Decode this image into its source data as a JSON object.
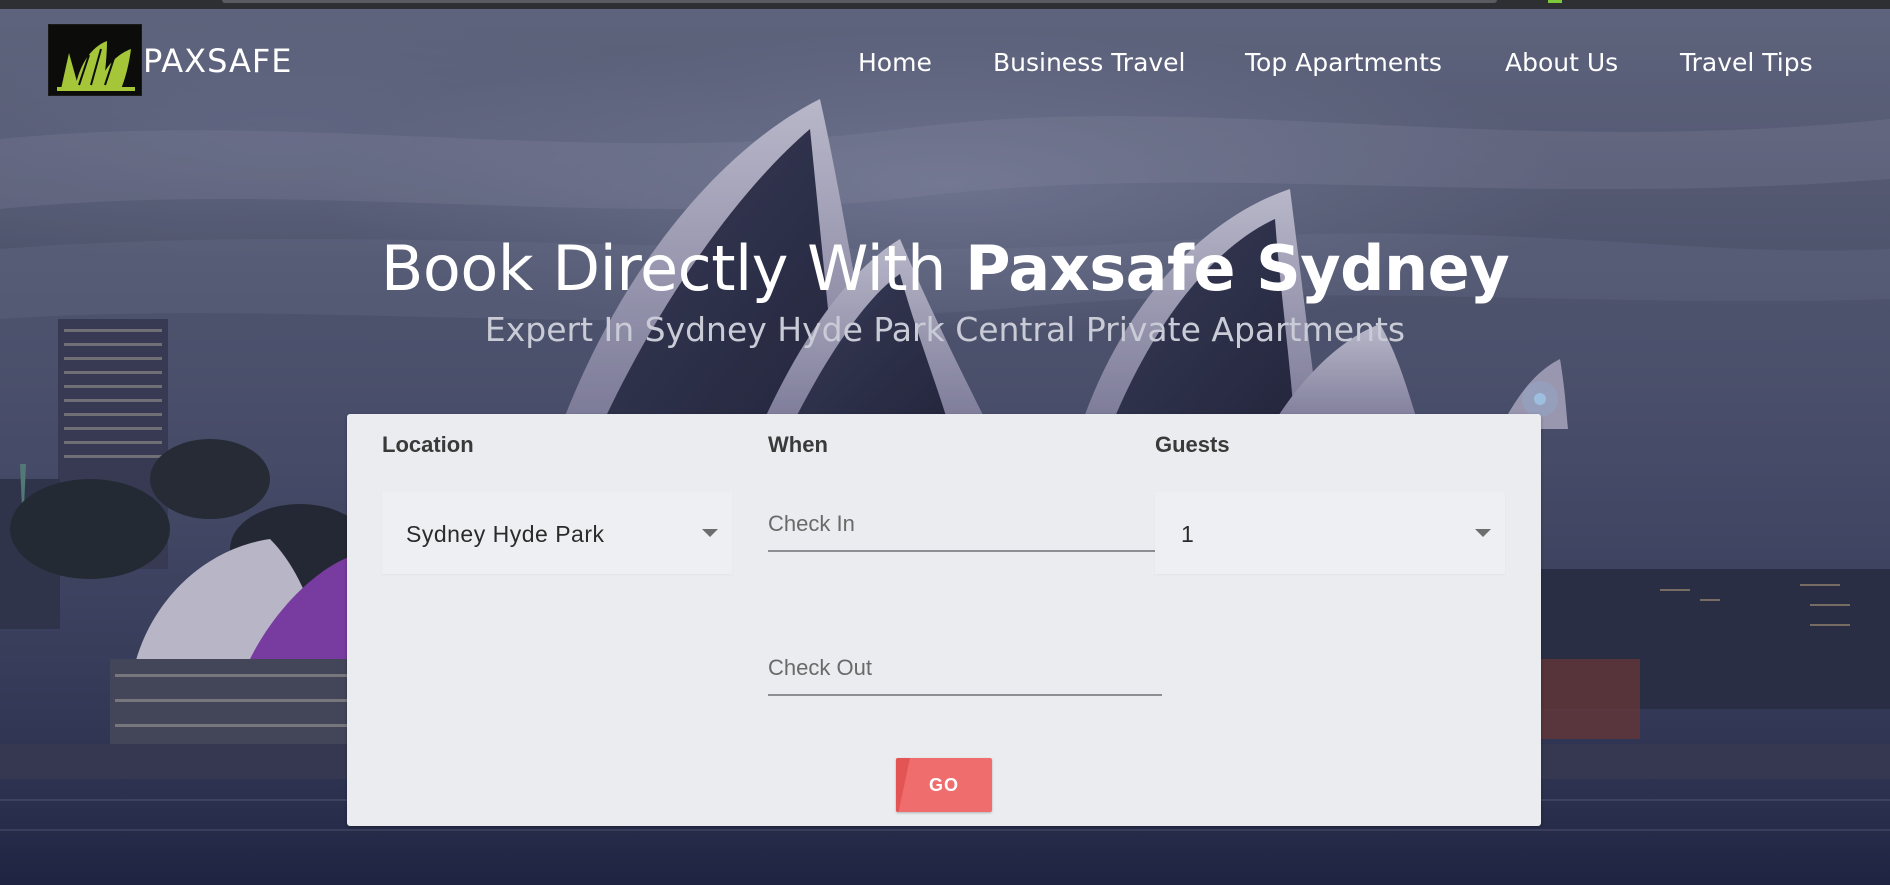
{
  "brand": {
    "name": "PAXSAFE",
    "logo_icon": "opera-house-logo-icon",
    "logo_color": "#a6c63a"
  },
  "nav": {
    "items": [
      {
        "label": "Home"
      },
      {
        "label": "Business Travel"
      },
      {
        "label": "Top Apartments"
      },
      {
        "label": "About Us"
      },
      {
        "label": "Travel Tips"
      }
    ]
  },
  "hero": {
    "headline_lead": "Book Directly With ",
    "headline_strong": "Paxsafe Sydney",
    "subheadline": "Expert In Sydney Hyde Park Central Private Apartments"
  },
  "search": {
    "location": {
      "label": "Location",
      "value": "Sydney Hyde Park"
    },
    "when": {
      "label": "When",
      "check_in_placeholder": "Check In",
      "check_out_placeholder": "Check Out"
    },
    "guests": {
      "label": "Guests",
      "value": "1"
    },
    "go_label": "GO"
  },
  "colors": {
    "accent": "#ef6d6d",
    "card_bg": "#eaecef"
  }
}
